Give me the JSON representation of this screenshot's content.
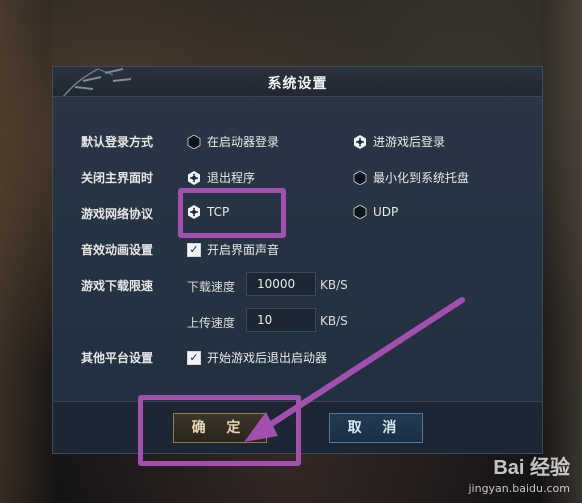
{
  "dialog": {
    "title": "系统设置",
    "rows": {
      "login_method": {
        "label": "默认登录方式",
        "option1": "在启动器登录",
        "option2": "进游戏后登录"
      },
      "close_main": {
        "label": "关闭主界面时",
        "option1": "退出程序",
        "option2": "最小化到系统托盘"
      },
      "network_protocol": {
        "label": "游戏网络协议",
        "option1": "TCP",
        "option2": "UDP"
      },
      "audio_anim": {
        "label": "音效动画设置",
        "checkbox_label": "开启界面声音",
        "checked": true
      },
      "download_limit": {
        "label": "游戏下载限速",
        "download_label": "下载速度",
        "download_value": "10000",
        "upload_label": "上传速度",
        "upload_value": "10",
        "unit": "KB/S"
      },
      "other_platform": {
        "label": "其他平台设置",
        "checkbox_label": "开始游戏后退出启动器",
        "checked": true
      }
    },
    "buttons": {
      "confirm": "确 定",
      "cancel": "取 消"
    }
  },
  "watermark": {
    "main": "Bai 经验",
    "sub": "jingyan.baidu.com"
  },
  "colors": {
    "highlight": "#a34fb0",
    "dialog_bg": "#243241"
  }
}
